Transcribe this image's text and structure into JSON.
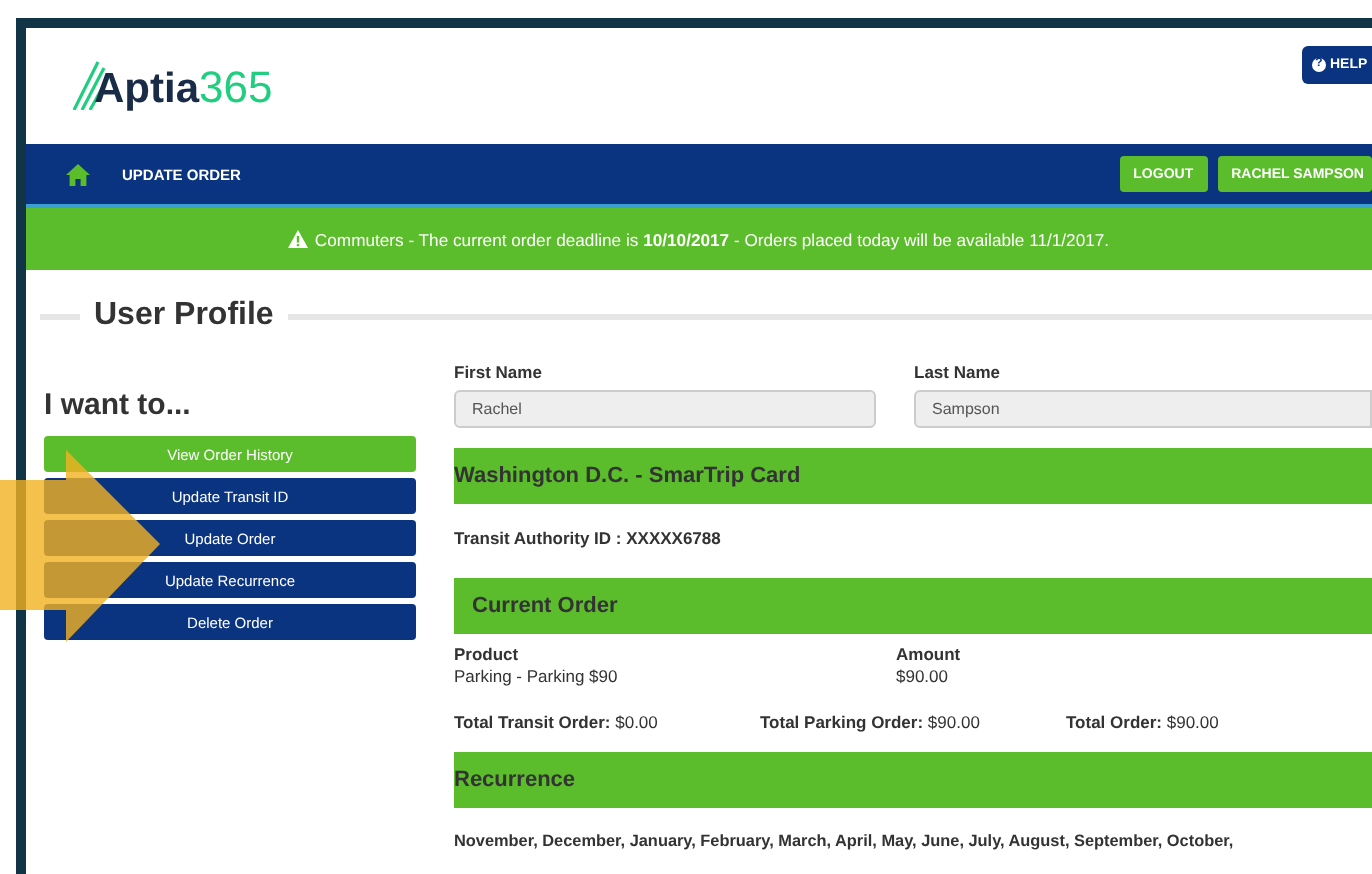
{
  "logo": {
    "name": "Aptia",
    "number": "365"
  },
  "help_button": {
    "icon": "?",
    "label": "HELP"
  },
  "nav": {
    "title": "UPDATE ORDER",
    "buttons": [
      "LOGOUT",
      "RACHEL SAMPSON"
    ]
  },
  "alert": "Commuters - The current order deadline is **10/10/2017** - Orders placed today will be available 11/1/2017.",
  "section_title": "User Profile",
  "menu": {
    "heading": "I want to...",
    "items": [
      {
        "label": "View Order History",
        "selected": true
      },
      {
        "label": "Update Transit ID",
        "selected": false
      },
      {
        "label": "Update Order",
        "selected": false
      },
      {
        "label": "Update Recurrence",
        "selected": false
      },
      {
        "label": "Delete Order",
        "selected": false
      }
    ]
  },
  "profile": {
    "fields": [
      {
        "label": "First Name",
        "value": "Rachel"
      },
      {
        "label": "Last Name",
        "value": "Sampson"
      }
    ]
  },
  "card": {
    "title": "Washington D.C. - SmarTrip Card",
    "transit_id": "Transit Authority ID : XXXXX6788"
  },
  "current_order": {
    "title": "Current Order",
    "columns": [
      "Product",
      "Amount"
    ],
    "rows": [
      [
        "Parking - Parking $90",
        "$90.00"
      ]
    ],
    "totals": [
      "**Total Transit Order:** $0.00",
      "**Total Parking Order:** $90.00",
      "**Total Order:** $90.00"
    ]
  },
  "recurrence": {
    "title": "Recurrence",
    "months": "November, December, January, February, March, April, May, June, July, August, September, October,"
  }
}
